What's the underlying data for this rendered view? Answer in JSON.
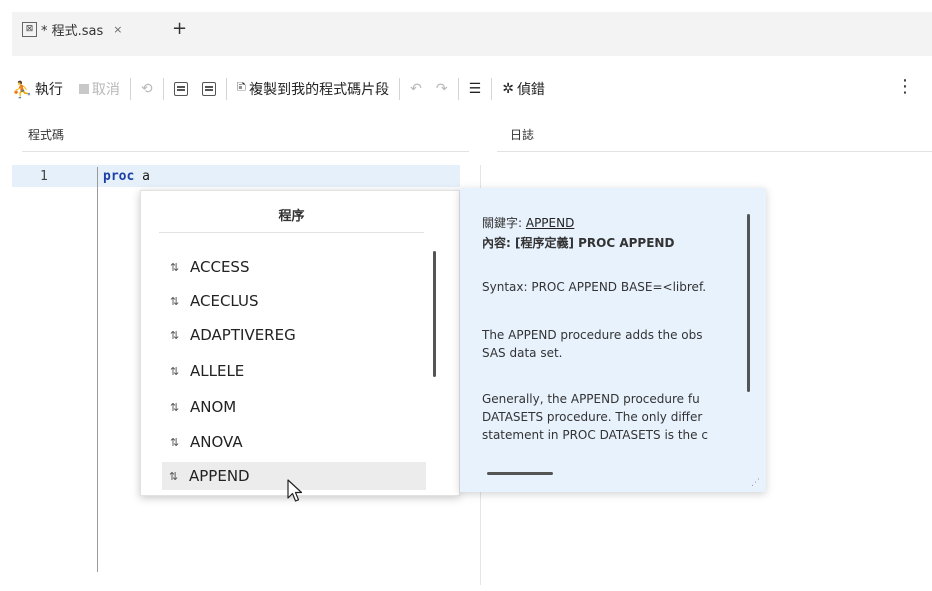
{
  "tabs": {
    "file_tab": "* 程式.sas",
    "close": "×",
    "add": "+"
  },
  "toolbar": {
    "run": "執行",
    "cancel": "取消",
    "copy_snippet": "複製到我的程式碼片段",
    "debug": "偵錯",
    "more": "⋮"
  },
  "panes": {
    "code": "程式碼",
    "log": "日誌"
  },
  "editor": {
    "line_number": "1",
    "keyword": "proc",
    "rest": " a"
  },
  "autocomplete": {
    "header": "程序",
    "items": [
      "ACCESS",
      "ACECLUS",
      "ADAPTIVEREG",
      "ALLELE",
      "ANOM",
      "ANOVA",
      "APPEND"
    ],
    "selected": "APPEND"
  },
  "info": {
    "keyword_label": "關鍵字: ",
    "keyword": "APPEND",
    "content": "內容: [程序定義] PROC APPEND",
    "syntax": "Syntax: PROC APPEND BASE=<libref.",
    "desc1": "The APPEND procedure adds the obs",
    "desc2": "SAS data set.",
    "gen1": "Generally, the APPEND procedure fu",
    "gen2": "DATASETS procedure. The only differ",
    "gen3": "statement in PROC DATASETS is the c"
  },
  "colors": {
    "accent_keyword": "#1c3fa8",
    "code_highlight": "#e6f0fa",
    "info_background": "#e8f2fd"
  }
}
